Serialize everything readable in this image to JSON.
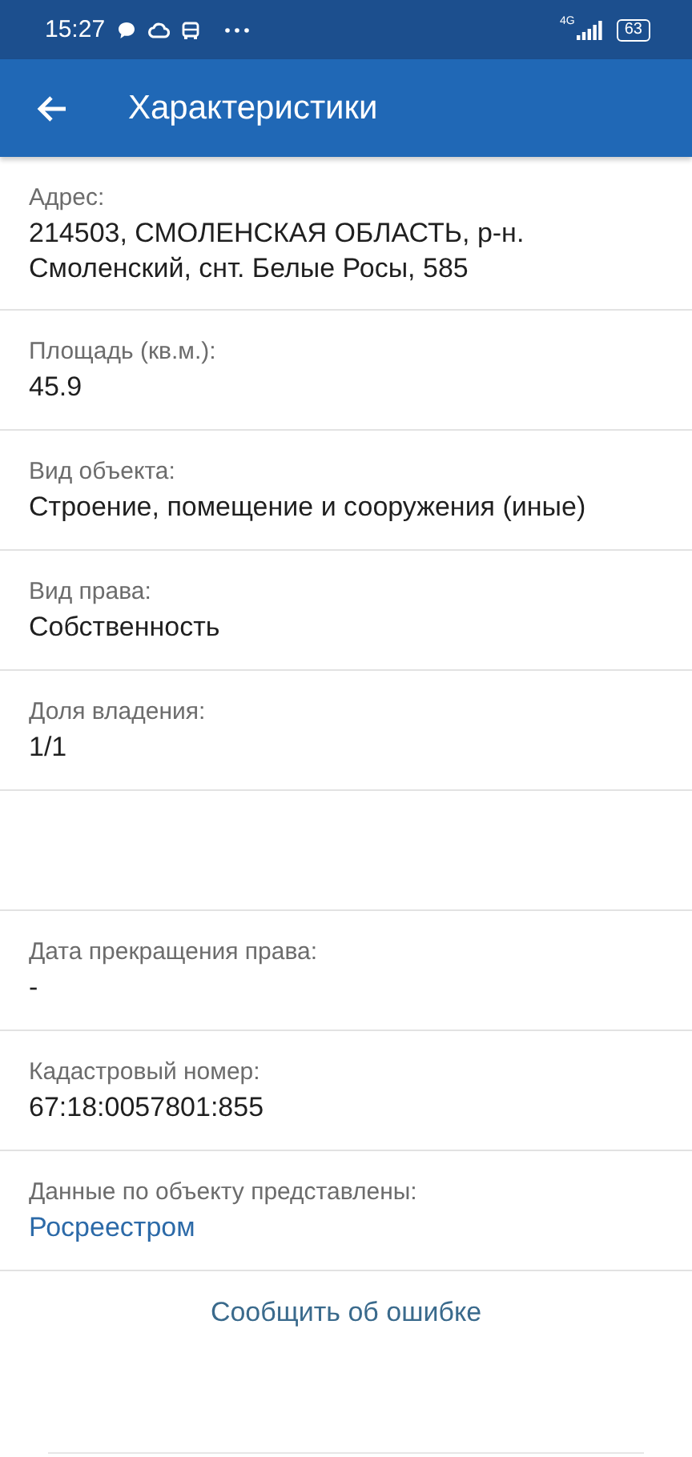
{
  "status_bar": {
    "time": "15:27",
    "network": "4G",
    "battery": "63"
  },
  "app_bar": {
    "title": "Характеристики"
  },
  "fields": [
    {
      "kind": "text",
      "label": "Адрес:",
      "value": "214503, СМОЛЕНСКАЯ ОБЛАСТЬ, р-н. Смоленский, снт. Белые Росы, 585"
    },
    {
      "kind": "text",
      "label": "Площадь (кв.м.):",
      "value": "45.9"
    },
    {
      "kind": "text",
      "label": "Вид объекта:",
      "value": "Строение, помещение и сооружения (иные)"
    },
    {
      "kind": "text",
      "label": "Вид права:",
      "value": "Собственность"
    },
    {
      "kind": "text",
      "label": "Доля владения:",
      "value": "1/1"
    },
    {
      "kind": "blank"
    },
    {
      "kind": "text",
      "label": "Дата прекращения права:",
      "value": "-"
    },
    {
      "kind": "text",
      "label": "Кадастровый номер:",
      "value": "67:18:0057801:855"
    },
    {
      "kind": "link",
      "label": "Данные по объекту представлены:",
      "value": "Росреестром"
    }
  ],
  "report_link": "Сообщить об ошибке"
}
